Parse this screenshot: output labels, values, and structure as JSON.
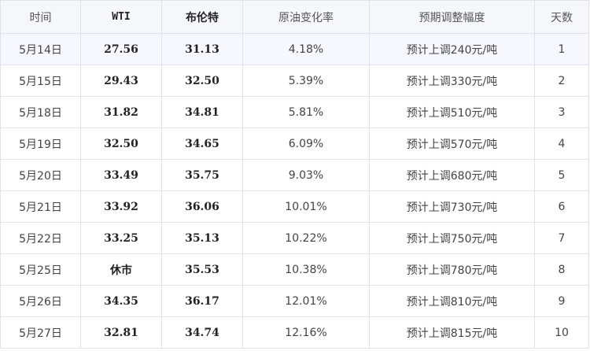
{
  "headers": [
    "时间",
    "WTI",
    "布伦特",
    "原油变化率",
    "预期调整幅度",
    "天数"
  ],
  "rows": [
    {
      "date": "5月14日",
      "wti": "27.56",
      "brent": "31.13",
      "rate": "4.18%",
      "adjust": "预计上调240元/吨",
      "days": "1"
    },
    {
      "date": "5月15日",
      "wti": "29.43",
      "brent": "32.50",
      "rate": "5.39%",
      "adjust": "预计上调330元/吨",
      "days": "2"
    },
    {
      "date": "5月18日",
      "wti": "31.82",
      "brent": "34.81",
      "rate": "5.81%",
      "adjust": "预计上调510元/吨",
      "days": "3"
    },
    {
      "date": "5月19日",
      "wti": "32.50",
      "brent": "34.65",
      "rate": "6.09%",
      "adjust": "预计上调570元/吨",
      "days": "4"
    },
    {
      "date": "5月20日",
      "wti": "33.49",
      "brent": "35.75",
      "rate": "9.03%",
      "adjust": "预计上调680元/吨",
      "days": "5"
    },
    {
      "date": "5月21日",
      "wti": "33.92",
      "brent": "36.06",
      "rate": "10.01%",
      "adjust": "预计上调730元/吨",
      "days": "6"
    },
    {
      "date": "5月22日",
      "wti": "33.25",
      "brent": "35.13",
      "rate": "10.22%",
      "adjust": "预计上调750元/吨",
      "days": "7"
    },
    {
      "date": "5月25日",
      "wti": "休市",
      "brent": "35.53",
      "rate": "10.38%",
      "adjust": "预计上调780元/吨",
      "days": "8"
    },
    {
      "date": "5月26日",
      "wti": "34.35",
      "brent": "36.17",
      "rate": "12.01%",
      "adjust": "预计上调810元/吨",
      "days": "9"
    },
    {
      "date": "5月27日",
      "wti": "32.81",
      "brent": "34.74",
      "rate": "12.16%",
      "adjust": "预计上调815元/吨",
      "days": "10"
    }
  ]
}
